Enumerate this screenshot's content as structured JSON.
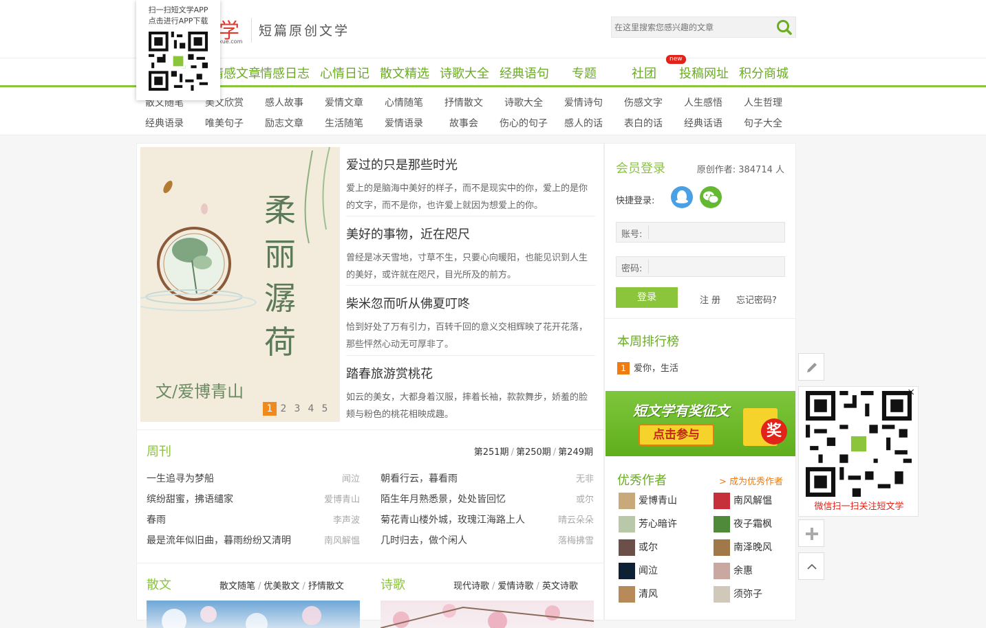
{
  "header": {
    "logo_char": "学",
    "logo_domain": "xue.com",
    "slogan": "短篇原创文学",
    "search_placeholder": "在这里搜索您感兴趣的文章"
  },
  "qr_popup": {
    "line1": "扫一扫短文学APP",
    "line2": "点击进行APP下载"
  },
  "main_nav": {
    "items": [
      "情感文章",
      "情感日志",
      "心情日记",
      "散文精选",
      "诗歌大全",
      "经典语句",
      "专题",
      "社团",
      "投稿网址",
      "积分商城"
    ],
    "new_badge": "new"
  },
  "sub_nav": {
    "row1": [
      "散文随笔",
      "美文欣赏",
      "感人故事",
      "爱情文章",
      "心情随笔",
      "抒情散文",
      "诗歌大全",
      "爱情诗句",
      "伤感文字",
      "人生感悟",
      "人生哲理"
    ],
    "row2": [
      "经典语录",
      "唯美句子",
      "励志文章",
      "生活随笔",
      "爱情语录",
      "故事会",
      "伤心的句子",
      "感人的话",
      "表白的话",
      "经典话语",
      "句子大全"
    ]
  },
  "banner": {
    "title_vertical": "柔丽潺荷",
    "author": "文/爱博青山",
    "pages": [
      "1",
      "2",
      "3",
      "4",
      "5"
    ],
    "active_page": "1"
  },
  "articles": [
    {
      "title": "爱过的只是那些时光",
      "desc": "爱上的是脑海中美好的样子，而不是现实中的你，爱上的是你的文字，而不是你，也许爱上就因为想爱上的你。"
    },
    {
      "title": "美好的事物，近在咫尺",
      "desc": "曾经是冰天雪地，寸草不生，只要心向暖阳，也能见识到人生的美好，或许就在咫尺，目光所及的前方。"
    },
    {
      "title": "柴米忽而听从佛夏叮咚",
      "desc": "恰到好处了万有引力，百转千回的意义交相辉映了花开花落，那些怦然心动无可厚非了。"
    },
    {
      "title": "踏春旅游赏桃花",
      "desc": "如云的美女，大都身着汉服，摔着长袖，款款舞步，娇羞的脸颊与粉色的桃花相映成趣。"
    }
  ],
  "weekly": {
    "title": "周刊",
    "issues": [
      "第251期",
      "第250期",
      "第249期"
    ],
    "left": [
      {
        "title": "一生追寻为梦船",
        "author": "闻泣"
      },
      {
        "title": "缤纷甜蜜，拂语缱家",
        "author": "爱博青山"
      },
      {
        "title": "春雨",
        "author": "李声波"
      },
      {
        "title": "最是流年似旧曲，暮雨纷纷又清明",
        "author": "南风解愠"
      }
    ],
    "right": [
      {
        "title": "朝看行云，暮看雨",
        "author": "无非"
      },
      {
        "title": "陌生年月熟悉景，处处皆回忆",
        "author": "或尔"
      },
      {
        "title": "菊花青山楼外城，玫瑰江海路上人",
        "author": "晴云朵朵"
      },
      {
        "title": "几时归去，做个闲人",
        "author": "落梅拂雪"
      }
    ]
  },
  "sections": {
    "prose": {
      "title": "散文",
      "links": [
        "散文随笔",
        "优美散文",
        "抒情散文"
      ]
    },
    "poetry": {
      "title": "诗歌",
      "links": [
        "现代诗歌",
        "爱情诗歌",
        "英文诗歌"
      ]
    }
  },
  "login": {
    "title": "会员登录",
    "member_count": "原创作者: 384714 人",
    "quick_label": "快捷登录:",
    "account_label": "账号:",
    "password_label": "密码:",
    "login_button": "登录",
    "register": "注 册",
    "forgot": "忘记密码?"
  },
  "ranking": {
    "title": "本周排行榜",
    "items": [
      {
        "num": "1",
        "title": "爱你，生活"
      }
    ]
  },
  "promo": {
    "headline": "短文学有奖征文",
    "cta": "点击参与",
    "badge": "奖"
  },
  "authors": {
    "title": "优秀作者",
    "become": "> 成为优秀作者",
    "left": [
      "爱博青山",
      "芳心暗许",
      "或尔",
      "闻泣",
      "清风"
    ],
    "right": [
      "南风解愠",
      "夜子霜枫",
      "南泽晚风",
      "余惠",
      "须弥子"
    ]
  },
  "float_qr": {
    "caption": "微信扫一扫关注短文学",
    "close": "×"
  },
  "colors": {
    "brand_green": "#8ac53c",
    "nav_green": "#6aac22",
    "orange": "#ef7b11",
    "red": "#e2231a"
  }
}
